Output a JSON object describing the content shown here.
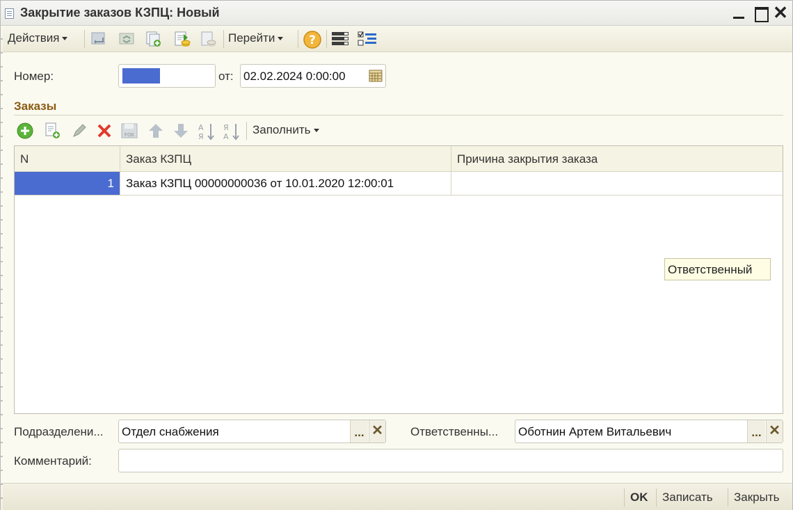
{
  "window": {
    "title": "Закрытие заказов КЗПЦ: Новый",
    "controls": [
      "minimize",
      "maximize",
      "close"
    ]
  },
  "toolbar": {
    "actions_label": "Действия",
    "goto_label": "Перейти",
    "icons": [
      "post-and-close-icon",
      "refresh-icon",
      "copy-document-icon",
      "post-document-icon",
      "unpost-document-icon",
      "help-icon",
      "structure-icon",
      "settings-list-icon"
    ]
  },
  "header": {
    "number_label": "Номер:",
    "number_value": "",
    "date_label": "от:",
    "date_value": "02.02.2024  0:00:00"
  },
  "orders": {
    "section_title": "Заказы",
    "fill_label": "Заполнить",
    "columns": [
      "N",
      "Заказ КЗПЦ",
      "Причина закрытия заказа"
    ],
    "rows": [
      {
        "n": "1",
        "order": "Заказ КЗПЦ 00000000036 от 10.01.2020 12:00:01",
        "reason": ""
      }
    ],
    "tooltip": "Ответственный"
  },
  "footer_fields": {
    "department_label": "Подразделени...",
    "department_value": "Отдел снабжения",
    "responsible_label": "Ответственны...",
    "responsible_value": "Оботнин Артем Витальевич",
    "comment_label": "Комментарий:",
    "comment_value": "",
    "select_button": "...",
    "clear_button": "✕"
  },
  "bottom_buttons": {
    "ok": "OK",
    "save": "Записать",
    "close": "Закрыть"
  },
  "colors": {
    "selection": "#4a6bd0",
    "section_title": "#8a5a14",
    "window_bg": "#fbfaf0"
  }
}
